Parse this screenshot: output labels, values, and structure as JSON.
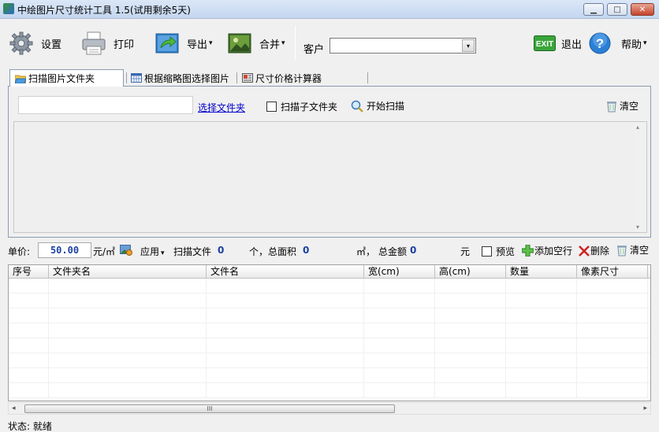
{
  "window": {
    "title": "中绘图片尺寸统计工具 1.5(试用剩余5天)",
    "min_label": "▁",
    "max_label": "□",
    "close_label": "✕"
  },
  "toolbar": {
    "settings_label": "设置",
    "print_label": "打印",
    "export_label": "导出",
    "merge_label": "合并",
    "customer_label": "客户",
    "customer_value": "",
    "exit_label": "退出",
    "exit_badge": "EXIT",
    "help_label": "帮助",
    "help_glyph": "?",
    "caret": "▾"
  },
  "tabs": [
    {
      "label": "扫描图片文件夹",
      "active": true
    },
    {
      "label": "根据缩略图选择图片",
      "active": false
    },
    {
      "label": "尺寸价格计算器",
      "active": false
    }
  ],
  "scan_panel": {
    "path_value": "",
    "choose_folder_link": "选择文件夹",
    "scan_subfolders_label": "扫描子文件夹",
    "start_scan_label": "开始扫描",
    "clear_label": "清空"
  },
  "stats": {
    "unit_price_label": "单价:",
    "unit_price_value": "50.00",
    "unit_label": "元/㎡",
    "apply_label": "应用",
    "scan_files_label": "扫描文件",
    "scan_files_count": "0",
    "total_area_label": "个，总面积",
    "total_area_value": "0",
    "area_unit_label": "㎡，",
    "total_amount_label": "总金额",
    "total_amount_value": "0",
    "currency_label": "元",
    "preview_label": "预览",
    "add_row_label": "添加空行",
    "delete_label": "删除",
    "clear_label": "清空"
  },
  "table": {
    "columns": [
      "序号",
      "文件夹名",
      "文件名",
      "宽(cm)",
      "高(cm)",
      "数量",
      "像素尺寸"
    ]
  },
  "scrollbar": {
    "left_arrow": "◂",
    "right_arrow": "▸",
    "thumb_grip": "III",
    "up_arrow": "▴",
    "down_arrow": "▾"
  },
  "status": {
    "text": "状态: 就绪"
  },
  "colors": {
    "link": "#0000cc",
    "number": "#1a3fa0",
    "exit_green": "#3aa53a",
    "help_blue": "#2a7fd4"
  }
}
